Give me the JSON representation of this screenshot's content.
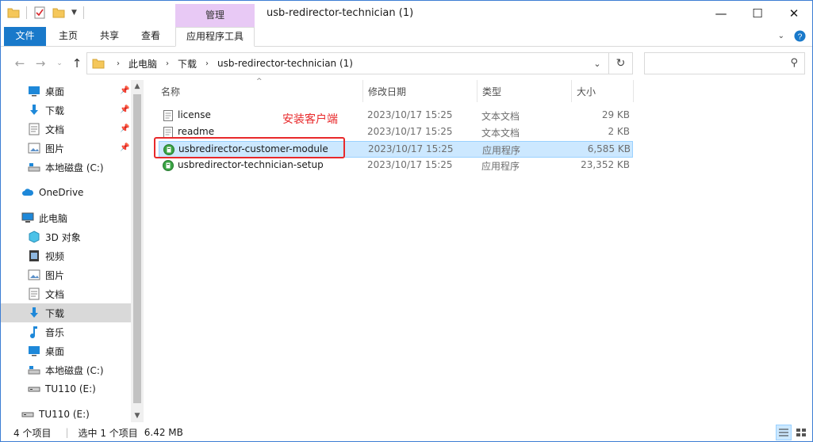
{
  "window": {
    "title": "usb-redirector-technician (1)",
    "context_tab_group": "管理",
    "minimize": "—",
    "maximize": "☐",
    "close": "✕"
  },
  "ribbon": {
    "tabs": [
      "文件",
      "主页",
      "共享",
      "查看",
      "应用程序工具"
    ]
  },
  "address": {
    "crumbs": [
      "此电脑",
      "下载",
      "usb-redirector-technician (1)"
    ],
    "search_placeholder": ""
  },
  "nav": {
    "quick_access": [
      {
        "label": "桌面",
        "icon": "desktop-icon",
        "pinned": true
      },
      {
        "label": "下载",
        "icon": "download-icon",
        "pinned": true
      },
      {
        "label": "文档",
        "icon": "documents-icon",
        "pinned": true
      },
      {
        "label": "图片",
        "icon": "pictures-icon",
        "pinned": true
      },
      {
        "label": "本地磁盘 (C:)",
        "icon": "drive-icon",
        "pinned": false
      }
    ],
    "onedrive": "OneDrive",
    "this_pc": "此电脑",
    "this_pc_items": [
      {
        "label": "3D 对象",
        "icon": "3d-objects-icon"
      },
      {
        "label": "视频",
        "icon": "videos-icon"
      },
      {
        "label": "图片",
        "icon": "pictures-icon"
      },
      {
        "label": "文档",
        "icon": "documents-icon"
      },
      {
        "label": "下载",
        "icon": "download-icon"
      },
      {
        "label": "音乐",
        "icon": "music-icon"
      },
      {
        "label": "桌面",
        "icon": "desktop-icon"
      },
      {
        "label": "本地磁盘 (C:)",
        "icon": "drive-icon"
      },
      {
        "label": "TU110 (E:)",
        "icon": "usb-drive-icon"
      }
    ],
    "extra": "TU110 (E:)"
  },
  "list": {
    "columns": [
      "名称",
      "修改日期",
      "类型",
      "大小"
    ],
    "rows": [
      {
        "name": "license",
        "date": "2023/10/17 15:25",
        "type": "文本文档",
        "size": "29 KB",
        "icon": "text-file-icon"
      },
      {
        "name": "readme",
        "date": "2023/10/17 15:25",
        "type": "文本文档",
        "size": "2 KB",
        "icon": "text-file-icon"
      },
      {
        "name": "usbredirector-customer-module",
        "date": "2023/10/17 15:25",
        "type": "应用程序",
        "size": "6,585 KB",
        "icon": "app-icon"
      },
      {
        "name": "usbredirector-technician-setup",
        "date": "2023/10/17 15:25",
        "type": "应用程序",
        "size": "23,352 KB",
        "icon": "app-icon"
      }
    ],
    "annotation": "安装客户端"
  },
  "status": {
    "count": "4 个项目",
    "selection": "选中 1 个项目",
    "size": "6.42 MB"
  },
  "colors": {
    "accent": "#1979ca",
    "selection": "#cce8ff",
    "annotation": "#e8292b"
  }
}
